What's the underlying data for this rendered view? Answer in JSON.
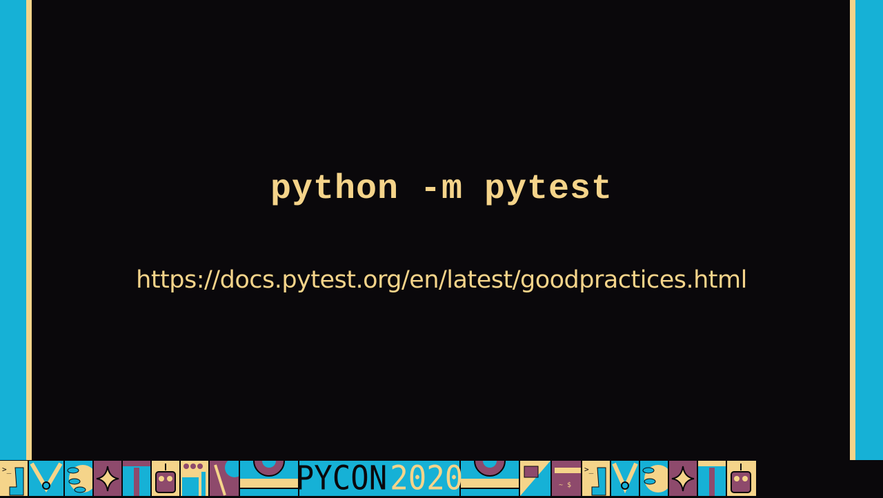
{
  "slide": {
    "command": "python -m pytest",
    "url": "https://docs.pytest.org/en/latest/goodpractices.html"
  },
  "banner": {
    "logo_word": "PYCON",
    "logo_year": "2020"
  },
  "colors": {
    "cyan": "#16b1d6",
    "cream": "#f5d48a",
    "plum": "#8e4a6c",
    "background": "#0a080b"
  }
}
